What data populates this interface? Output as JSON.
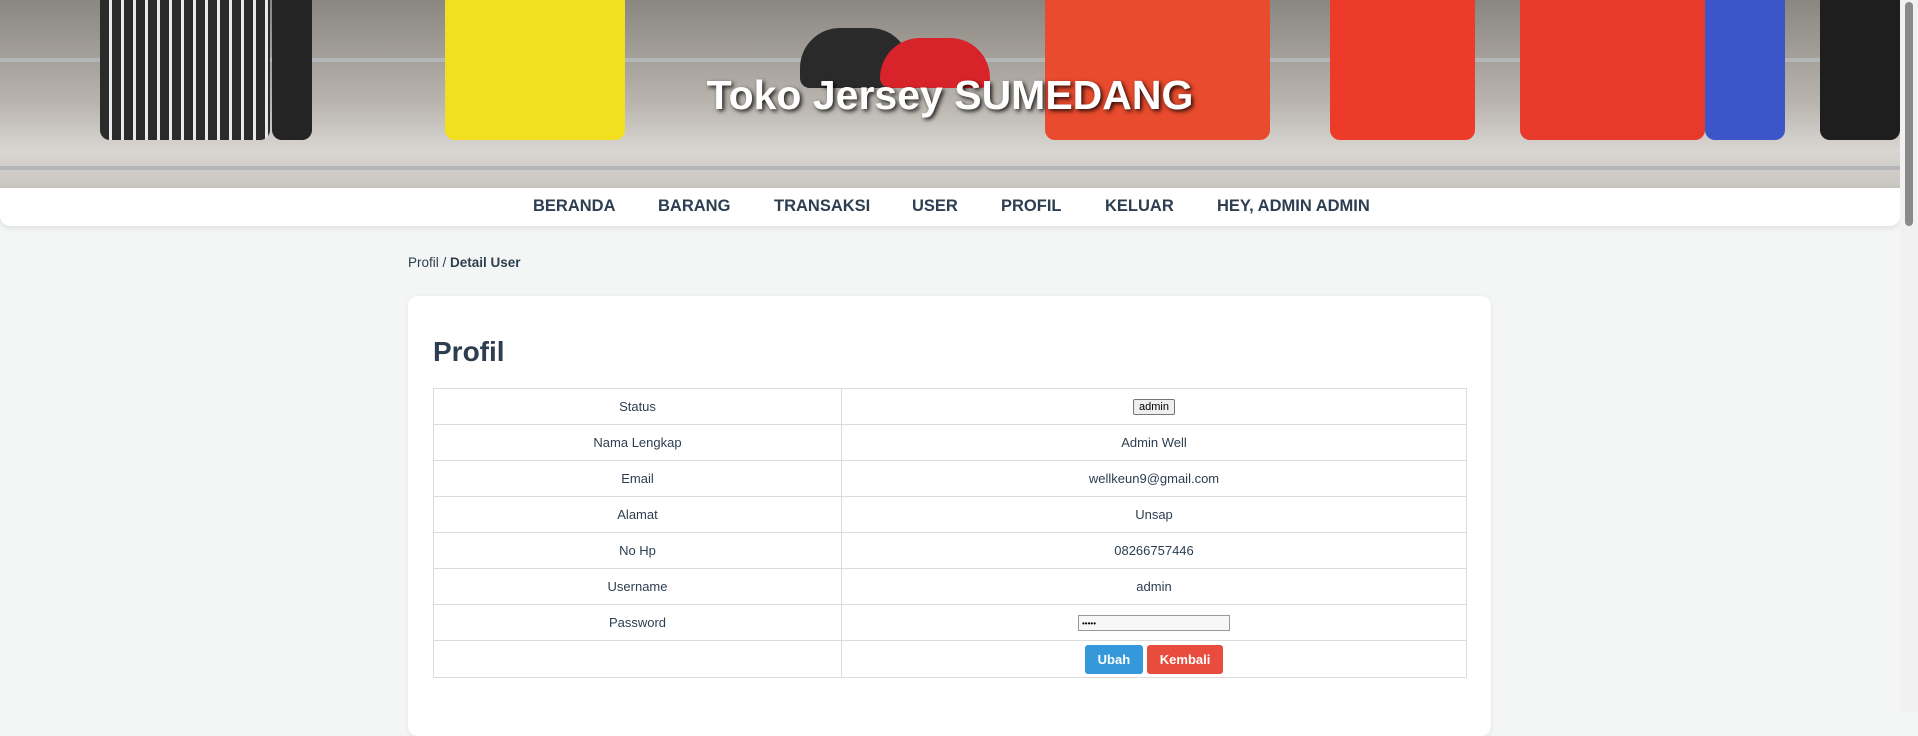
{
  "header": {
    "title": "Toko Jersey SUMEDANG",
    "jersey_colors": [
      "#2b2b2b",
      "#f2df1f",
      "#2a2a2a",
      "#d9232a",
      "#e94b2e",
      "#e83a2a",
      "#3c56c9"
    ]
  },
  "nav": {
    "items": [
      {
        "label": "BERANDA"
      },
      {
        "label": "BARANG"
      },
      {
        "label": "TRANSAKSI"
      },
      {
        "label": "USER"
      },
      {
        "label": "PROFIL"
      },
      {
        "label": "KELUAR"
      },
      {
        "label": "HEY, ADMIN ADMIN"
      }
    ]
  },
  "breadcrumb": {
    "link": "Profil",
    "separator": " / ",
    "current": "Detail User"
  },
  "profile": {
    "title": "Profil",
    "rows": [
      {
        "label": "Status",
        "value": "admin"
      },
      {
        "label": "Nama Lengkap",
        "value": "Admin Well"
      },
      {
        "label": "Email",
        "value": "wellkeun9@gmail.com"
      },
      {
        "label": "Alamat",
        "value": "Unsap"
      },
      {
        "label": "No Hp",
        "value": "08266757446"
      },
      {
        "label": "Username",
        "value": "admin"
      },
      {
        "label": "Password",
        "value": "•••••"
      }
    ],
    "buttons": {
      "edit": "Ubah",
      "back": "Kembali"
    }
  },
  "colors": {
    "primary": "#3498db",
    "danger": "#e74c3c",
    "text": "#2c3e50",
    "background": "#f4f6f6"
  }
}
